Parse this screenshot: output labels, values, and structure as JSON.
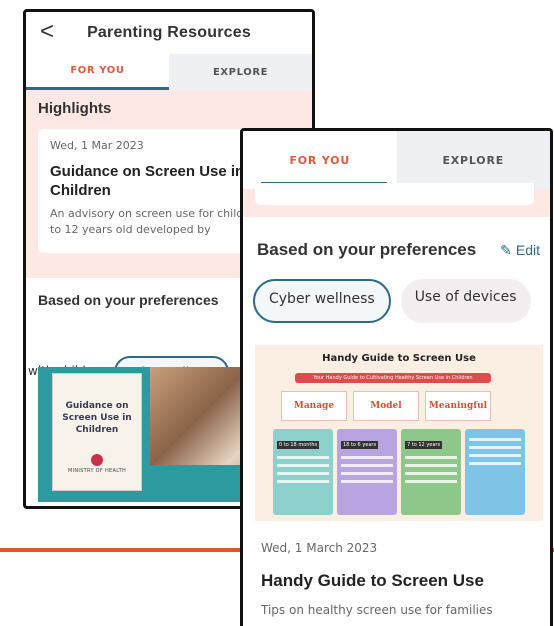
{
  "back_screen": {
    "header": {
      "back_glyph": "<",
      "title": "Parenting Resources"
    },
    "tabs": [
      {
        "label": "FOR YOU",
        "active": true
      },
      {
        "label": "EXPLORE",
        "active": false
      }
    ],
    "highlights": {
      "title": "Highlights",
      "card": {
        "date": "Wed, 1 Mar 2023",
        "title": "Guidance on Screen Use in Children",
        "description": "An advisory on screen use for children up to 12 years old developed by"
      }
    },
    "preferences": {
      "title": "Based on your preferences",
      "chips": [
        "with child",
        "Cyber wellness"
      ]
    },
    "image": {
      "doc_title": "Guidance on Screen Use in Children",
      "doc_org": "MINISTRY OF HEALTH"
    }
  },
  "front_screen": {
    "tabs": [
      {
        "label": "FOR YOU",
        "active": true
      },
      {
        "label": "EXPLORE",
        "active": false
      }
    ],
    "preferences": {
      "title": "Based on your preferences",
      "edit_label": "Edit",
      "chips": [
        {
          "label": "Cyber wellness",
          "selected": true
        },
        {
          "label": "Use of devices",
          "selected": false
        }
      ]
    },
    "article": {
      "infographic": {
        "title": "Handy Guide to Screen Use",
        "banner": "Your Handy Guide to Cultivating Healthy Screen Use in Children",
        "boxes": [
          "Manage",
          "Model",
          "Meaningful"
        ],
        "columns": [
          "0 to 18 months",
          "18 to 6 years",
          "7 to 12 years",
          ""
        ]
      },
      "date": "Wed, 1 March 2023",
      "title": "Handy Guide to Screen Use",
      "description": "Tips on healthy screen use for families"
    }
  },
  "colors": {
    "accent_orange": "#e8542a",
    "tab_active_text": "#e05a3e",
    "teal_underline": "#2b6a8a",
    "highlight_bg": "#fde8e4"
  }
}
